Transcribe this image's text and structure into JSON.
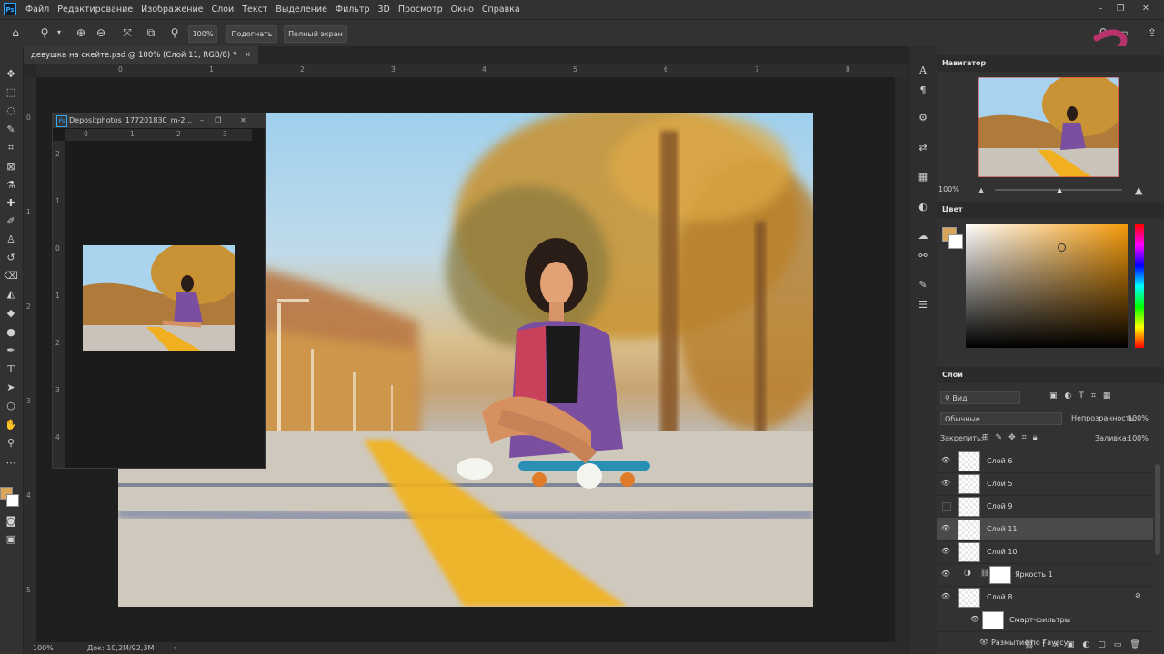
{
  "app": {
    "logo": "Ps",
    "menus": [
      "Файл",
      "Редактирование",
      "Изображение",
      "Слои",
      "Текст",
      "Выделение",
      "Фильтр",
      "3D",
      "Просмотр",
      "Окно",
      "Справка"
    ]
  },
  "options_bar": {
    "zoom_value": "100%",
    "fit_label": "Подогнать",
    "fullscreen_label": "Полный экран"
  },
  "document": {
    "tab_title": "девушка на скейте.psd @ 100% (Слой 11, RGB/8) *",
    "ruler_top_ticks": [
      "0",
      "1",
      "2",
      "3",
      "4",
      "5",
      "6",
      "7",
      "8"
    ],
    "ruler_left_ticks": [
      "0",
      "1",
      "2",
      "3",
      "4",
      "5"
    ]
  },
  "floating_window": {
    "title": "Depositphotos_177201830_m-2...",
    "ruler_top_ticks": [
      "0",
      "1",
      "2",
      "3"
    ],
    "ruler_left_ticks": [
      "2",
      "1",
      "0",
      "1",
      "2",
      "3",
      "4"
    ]
  },
  "status": {
    "zoom": "100%",
    "doc_size": "Док: 10,2M/92,3M"
  },
  "navigator": {
    "title": "Навигатор",
    "zoom": "100%"
  },
  "color_panel": {
    "title": "Цвет",
    "foreground": "#d9a55b",
    "background": "#ffffff"
  },
  "layers_panel": {
    "title": "Слои",
    "filter_label": "Вид",
    "blend_mode": "Обычные",
    "opacity_label": "Непрозрачность:",
    "opacity_value": "100%",
    "lock_label": "Закрепить:",
    "fill_label": "Заливка:",
    "fill_value": "100%",
    "layers": [
      {
        "name": "Слой 6",
        "visible": true
      },
      {
        "name": "Слой 5",
        "visible": true
      },
      {
        "name": "Слой 9",
        "visible": false
      },
      {
        "name": "Слой 11",
        "visible": true,
        "selected": true
      },
      {
        "name": "Слой 10",
        "visible": true
      },
      {
        "name": "Яркость 1",
        "visible": true,
        "adjustment": true
      },
      {
        "name": "Слой 8",
        "visible": true
      },
      {
        "name": "Смарт-фильтры",
        "visible": true,
        "sub": true
      },
      {
        "name": "Размытие по Гауссу",
        "visible": true,
        "sub": true
      }
    ]
  },
  "colors": {
    "accent": "#31a8ff",
    "ui_dark": "#323232"
  }
}
